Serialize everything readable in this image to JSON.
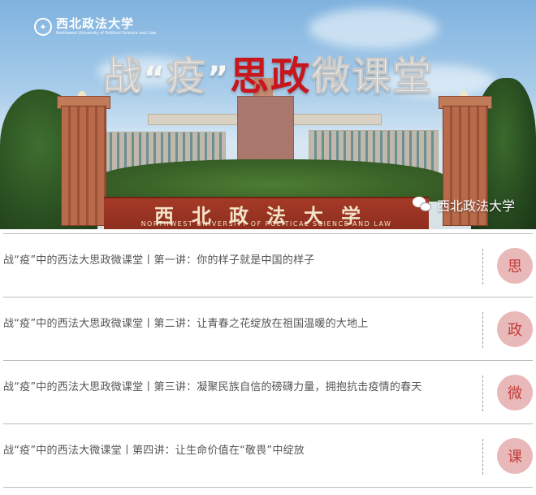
{
  "banner": {
    "logo_name": "西北政法大学",
    "logo_subtitle": "Northwest University of Political Science and Law",
    "title": {
      "part1": "战",
      "quote_open": "“",
      "part2": "疫",
      "quote_close": "”",
      "part3_red": "思政",
      "part4": "微课堂"
    },
    "gate_sign_cn": "西北政法大学",
    "gate_sign_en": "NORTHWEST UNIVERSITY OF POLITICAL SCIENCE AND LAW",
    "watermark": "西北政法大学",
    "watermark_icon": "wechat-icon",
    "accent_red": "#c8161d"
  },
  "articles": [
    {
      "title": "战“疫”中的西法大思政微课堂丨第一讲：你的样子就是中国的样子",
      "badge": "思"
    },
    {
      "title": "战“疫”中的西法大思政微课堂丨第二讲：让青春之花绽放在祖国温暖的大地上",
      "badge": "政"
    },
    {
      "title": "战“疫”中的西法大思政微课堂丨第三讲：凝聚民族自信的磅礴力量，拥抱抗击疫情的春天",
      "badge": "微"
    },
    {
      "title": "战“疫”中的西法大微课堂丨第四讲：让生命价值在“敬畏”中绽放",
      "badge": "课"
    }
  ],
  "colors": {
    "badge_bg": "#e9b8b8",
    "badge_text": "#c23b3b",
    "divider": "#bdbdbd"
  }
}
